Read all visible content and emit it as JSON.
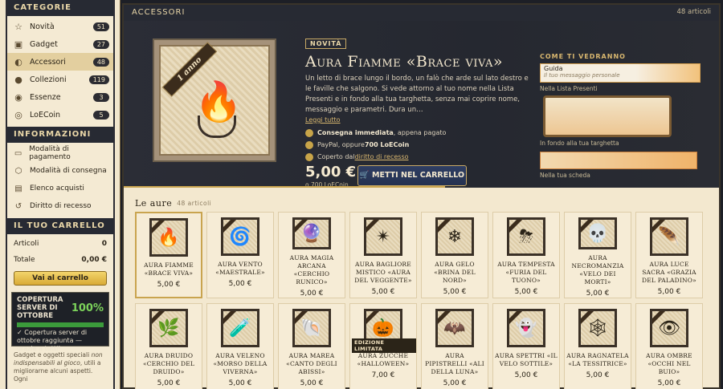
{
  "sidebar": {
    "categories_title": "CATEGORIE",
    "categories": [
      {
        "label": "Novità",
        "count": "51",
        "icon": "star-icon",
        "glyph": "☆"
      },
      {
        "label": "Gadget",
        "count": "27",
        "icon": "gadget-icon",
        "glyph": "▣"
      },
      {
        "label": "Accessori",
        "count": "48",
        "icon": "accessory-icon",
        "glyph": "◐"
      },
      {
        "label": "Collezioni",
        "count": "119",
        "icon": "collection-icon",
        "glyph": "●"
      },
      {
        "label": "Essenze",
        "count": "3",
        "icon": "essence-icon",
        "glyph": "◉"
      },
      {
        "label": "LoECoin",
        "count": "5",
        "icon": "coin-icon",
        "glyph": "◎"
      }
    ],
    "info_title": "INFORMAZIONI",
    "info": [
      {
        "label": "Modalità di pagamento",
        "icon": "card-icon",
        "glyph": "▭"
      },
      {
        "label": "Modalità di consegna",
        "icon": "box-icon",
        "glyph": "⬡"
      },
      {
        "label": "Elenco acquisti",
        "icon": "list-icon",
        "glyph": "▤"
      },
      {
        "label": "Diritto di recesso",
        "icon": "undo-icon",
        "glyph": "↺"
      }
    ],
    "cart_title": "IL TUO CARRELLO",
    "cart_articles_label": "Articoli",
    "cart_articles_value": "0",
    "cart_total_label": "Totale",
    "cart_total_value": "0,00 €",
    "cart_button": "Vai al carrello",
    "server_title": "COPERTURA SERVER DI OTTOBRE",
    "server_pct": "100%",
    "server_progress": 1.0,
    "server_msg": "✓ Copertura server di ottobre raggiunta — grazie a tutti!",
    "footer_a": "Gadget e oggetti speciali ",
    "footer_b": "non indispensabili al gioco",
    "footer_c": ", utili a migliorarne alcuni aspetti. Ogni"
  },
  "main": {
    "title": "ACCESSORI",
    "count": "48 articoli"
  },
  "hero": {
    "ribbon": "1 anno",
    "badge": "NOVITÀ",
    "title": "Aura Fiamme «Brace viva»",
    "desc": "Un letto di brace lungo il bordo, un falò che arde sul lato destro e le faville che salgono. Si vede attorno al tuo nome nella Lista Presenti e in fondo alla tua targhetta, senza mai coprire nome, messaggio e parametri. Dura un…",
    "read_more": "Leggi tutto",
    "feat1_bold": "Consegna immediata",
    "feat1_rest": ", appena pagato",
    "feat2_text": "PayPal, oppure ",
    "feat2_bold": "700 LoECoin",
    "feat3_text": "Coperto dal ",
    "feat3_link": "diritto di recesso",
    "price": "5,00 €",
    "price_alt": "o 700 LoECoin",
    "buy_button": "METTI NEL CARRELLO"
  },
  "preview": {
    "title": "COME TI VEDRANNO",
    "box1_name": "Guida",
    "box1_msg": "Il tuo messaggio personale",
    "cap1": "Nella Lista Presenti",
    "cap2": "In fondo alla tua targhetta",
    "cap3": "Nella tua scheda"
  },
  "section": {
    "title": "Le aure",
    "count": "48 articoli"
  },
  "products": [
    {
      "name": "Aura Fiamme «Brace viva»",
      "price": "5,00 €",
      "emoji": "🔥",
      "selected": true
    },
    {
      "name": "Aura Vento «Maestrale»",
      "price": "5,00 €",
      "emoji": "🌀"
    },
    {
      "name": "Aura Magia arcana «Cerchio runico»",
      "price": "5,00 €",
      "emoji": "🔮"
    },
    {
      "name": "Aura Bagliore mistico «Aura del veggente»",
      "price": "5,00 €",
      "emoji": "✴"
    },
    {
      "name": "Aura Gelo «Brina del Nord»",
      "price": "5,00 €",
      "emoji": "❄"
    },
    {
      "name": "Aura Tempesta «Furia del tuono»",
      "price": "5,00 €",
      "emoji": "⛈"
    },
    {
      "name": "Aura Necromanzia «Velo dei morti»",
      "price": "5,00 €",
      "emoji": "💀"
    },
    {
      "name": "Aura Luce sacra «Grazia del paladino»",
      "price": "5,00 €",
      "emoji": "🪶"
    },
    {
      "name": "Aura Druido «Cerchio del druido»",
      "price": "5,00 €",
      "emoji": "🌿"
    },
    {
      "name": "Aura Veleno «Morso della viverna»",
      "price": "5,00 €",
      "emoji": "🧪"
    },
    {
      "name": "Aura Marea «Canto degli abissi»",
      "price": "5,00 €",
      "emoji": "🐚"
    },
    {
      "name": "Aura Zucche «Halloween»",
      "price": "7,00 €",
      "emoji": "🎃",
      "limited": "EDIZIONE LIMITATA"
    },
    {
      "name": "Aura Pipistrelli «Ali della luna»",
      "price": "5,00 €",
      "emoji": "🦇"
    },
    {
      "name": "Aura Spettri «Il velo sottile»",
      "price": "5,00 €",
      "emoji": "👻"
    },
    {
      "name": "Aura Ragnatela «La tessitrice»",
      "price": "5,00 €",
      "emoji": "🕸"
    },
    {
      "name": "Aura Ombre «Occhi nel buio»",
      "price": "5,00 €",
      "emoji": "👁"
    }
  ]
}
